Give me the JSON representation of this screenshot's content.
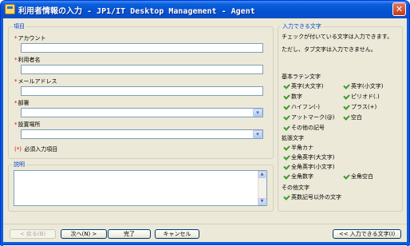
{
  "window": {
    "title": "利用者情報の入力 - JP1/IT Desktop Management - Agent",
    "close_glyph": "✕"
  },
  "form": {
    "group_label": "項目",
    "required_mark": "*",
    "fields": [
      {
        "label": "アカウント",
        "value": ""
      },
      {
        "label": "利用者名",
        "value": ""
      },
      {
        "label": "メールアドレス",
        "value": ""
      }
    ],
    "dropdowns": [
      {
        "label": "部署",
        "value": ""
      },
      {
        "label": "設置場所",
        "value": ""
      }
    ],
    "required_note_mark": "(*)",
    "required_note": "必須入力項目"
  },
  "description": {
    "group_label": "説明",
    "value": ""
  },
  "chars": {
    "group_label": "入力できる文字",
    "intro1": "チェックが付いている文字は入力できます。",
    "intro2": "ただし、タブ文字は入力できません。",
    "basic_title": "基本ラテン文字",
    "basic_items": [
      "英字(大文字)",
      "英字(小文字)",
      "数字",
      "ピリオド(.)",
      "ハイフン(-)",
      "プラス(+)",
      "アットマーク(@)",
      "空白",
      "その他の記号"
    ],
    "ext_title": "拡張文字",
    "ext_items": [
      "半角カナ",
      "全角英字(大文字)",
      "全角英字(小文字)",
      "全角数字",
      "全角空白"
    ],
    "other_title": "その他文字",
    "other_items": [
      "英数記号以外の文字"
    ]
  },
  "buttons": {
    "back": "< 戻る(B)",
    "next": "次へ(N) >",
    "finish": "完了",
    "cancel": "キャンセル",
    "toggle": "<< 入力できる文字(I)"
  }
}
